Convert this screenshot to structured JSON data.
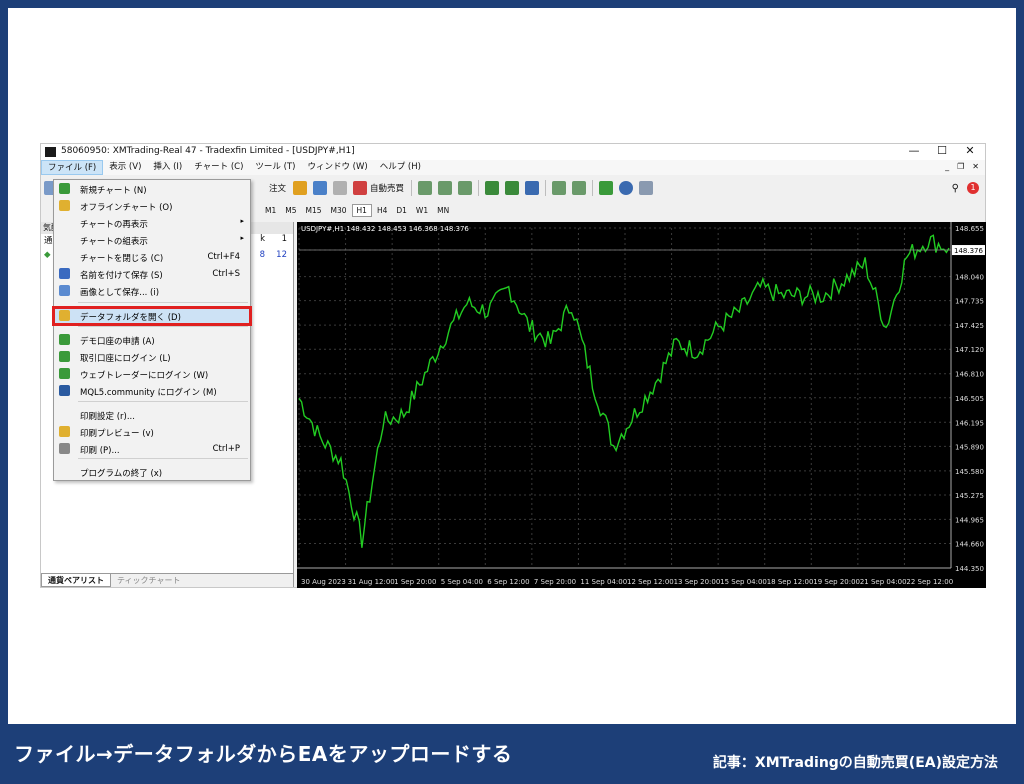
{
  "window": {
    "title": "58060950: XMTrading-Real 47 - Tradexfin Limited - [USDJPY#,H1]",
    "min": "—",
    "max": "☐",
    "close": "✕"
  },
  "menu": [
    "ファイル (F)",
    "表示 (V)",
    "挿入 (I)",
    "チャート (C)",
    "ツール (T)",
    "ウィンドウ (W)",
    "ヘルプ (H)"
  ],
  "toolbar": {
    "order_label": "注文",
    "auto_trade": "自動売買"
  },
  "timeframes": [
    "M1",
    "M5",
    "M15",
    "M30",
    "H1",
    "H4",
    "D1",
    "W1",
    "MN"
  ],
  "panel": {
    "head": "気配",
    "row1": {
      "label": "通",
      "c1": "k",
      "c2": "1"
    },
    "row2": {
      "label": "◆",
      "c1": "8",
      "c2": "12"
    },
    "tab1": "通貨ペアリスト",
    "tab2": "ティックチャート"
  },
  "chart": {
    "header": "USDJPY#,H1  148.432 148.453 146.368 148.376",
    "price_tag": "148.376",
    "line_color": "#22cc22"
  },
  "dropdown": {
    "items": [
      {
        "label": "新規チャート (N)",
        "shortcut": "",
        "color": "#3a9a3a"
      },
      {
        "label": "オフラインチャート (O)",
        "shortcut": "",
        "color": "#e0b030"
      },
      {
        "label": "チャートの再表示",
        "shortcut": "",
        "arrow": "▸"
      },
      {
        "label": "チャートの組表示",
        "shortcut": "",
        "arrow": "▸"
      },
      {
        "label": "チャートを閉じる (C)",
        "shortcut": "Ctrl+F4"
      },
      {
        "label": "名前を付けて保存 (S)",
        "shortcut": "Ctrl+S",
        "color": "#3a6ac0"
      },
      {
        "label": "画像として保存... (i)",
        "shortcut": "",
        "color": "#5a8ad0"
      },
      {
        "label": "データフォルダを開く (D)",
        "shortcut": "",
        "color": "#e0b030"
      },
      {
        "label": "デモ口座の申請 (A)",
        "shortcut": "",
        "color": "#3a9a3a"
      },
      {
        "label": "取引口座にログイン (L)",
        "shortcut": "",
        "color": "#3a9a3a"
      },
      {
        "label": "ウェブトレーダーにログイン (W)",
        "shortcut": "",
        "color": "#3a9a3a"
      },
      {
        "label": "MQL5.community にログイン (M)",
        "shortcut": "",
        "color": "#2a5aa0"
      },
      {
        "label": "印刷設定 (r)...",
        "shortcut": ""
      },
      {
        "label": "印刷プレビュー (v)",
        "shortcut": "",
        "color": "#e0b030"
      },
      {
        "label": "印刷 (P)...",
        "shortcut": "Ctrl+P",
        "color": "#888888"
      },
      {
        "label": "プログラムの終了 (x)",
        "shortcut": ""
      }
    ]
  },
  "caption": "ファイル→データフォルダからEAをアップロードする",
  "article": "記事：XMTradingの自動売買(EA)設定方法",
  "chart_data": {
    "type": "line",
    "x": [
      "30 Aug 2023",
      "31 Aug 12:00",
      "1 Sep 20:00",
      "5 Sep 04:00",
      "6 Sep 12:00",
      "7 Sep 20:00",
      "11 Sep 04:00",
      "12 Sep 12:00",
      "13 Sep 20:00",
      "15 Sep 04:00",
      "18 Sep 12:00",
      "19 Sep 20:00",
      "21 Sep 04:00",
      "22 Sep 12:00"
    ],
    "y_ticks": [
      148.655,
      148.376,
      148.04,
      147.735,
      147.425,
      147.12,
      146.81,
      146.505,
      146.195,
      145.89,
      145.58,
      145.275,
      144.965,
      144.66,
      144.35
    ],
    "ylim": [
      144.35,
      148.655
    ],
    "values": [
      146.5,
      146.0,
      145.7,
      144.7,
      146.2,
      146.3,
      146.8,
      147.3,
      147.7,
      147.6,
      147.9,
      147.4,
      147.2,
      147.7,
      146.7,
      145.9,
      146.3,
      146.7,
      147.2,
      147.1,
      147.4,
      147.6,
      147.9,
      147.8,
      147.8,
      147.8,
      148.0,
      148.2,
      147.4,
      148.3,
      148.5,
      148.4
    ]
  }
}
